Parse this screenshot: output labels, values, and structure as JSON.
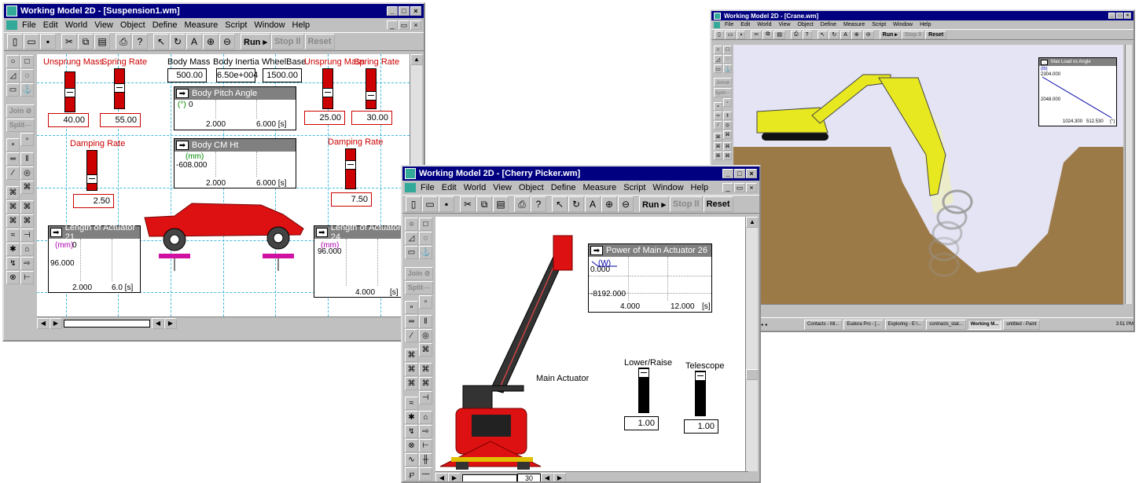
{
  "window1": {
    "title": "Working Model 2D - [Suspension1.wm]",
    "menus": [
      "File",
      "Edit",
      "World",
      "View",
      "Object",
      "Define",
      "Measure",
      "Script",
      "Window",
      "Help"
    ],
    "run": "Run ▸",
    "stop": "Stop ll",
    "reset": "Reset",
    "join": "Join ⊘",
    "split": "Split⋯",
    "labels": {
      "unsprung_mass": "Unsprung Mass",
      "spring_rate": "Spring Rate",
      "body_mass": "Body Mass",
      "body_inertia": "Body Inertia",
      "wheelbase": "WheelBase",
      "unsprung_mass_2": "Unsprung Mass",
      "spring_rate_2": "Spring Rate",
      "damping_rate": "Damping Rate",
      "damping_rate_2": "Damping Rate"
    },
    "values": {
      "unsprung_mass": "40.00",
      "spring_rate": "55.00",
      "body_mass": "500.00",
      "body_inertia": "6.50e+004",
      "wheelbase": "1500.00",
      "unsprung_mass_2": "25.00",
      "spring_rate_2": "30.00",
      "damping_rate": "2.50",
      "damping_rate_2": "7.50"
    },
    "meters": {
      "pitch": {
        "title": "Body Pitch Angle",
        "unit": "(°)",
        "y": "0",
        "x1": "2.000",
        "x2": "6.000  [s]"
      },
      "cm": {
        "title": "Body CM Ht",
        "unit": "(mm)",
        "y": "-608.000",
        "x1": "2.000",
        "x2": "6.000  [s]"
      },
      "act21": {
        "title": "Length of Actuator 21",
        "unit": "(mm)",
        "y0": "0",
        "y": "96.000",
        "x1": "2.000",
        "x2": "6.0  [s]"
      },
      "act24": {
        "title": "Length of Actuator 24",
        "unit": "(mm)",
        "y": "96.000",
        "x2": "4.000",
        "x3": "[s]"
      }
    },
    "scroll_value": ""
  },
  "window2": {
    "title": "Working Model 2D - [Crane.wm]",
    "menus": [
      "File",
      "Edit",
      "World",
      "View",
      "Object",
      "Define",
      "Measure",
      "Script",
      "Window",
      "Help"
    ],
    "run": "Run ▸",
    "stop": "Stop ll",
    "reset": "Reset",
    "join": "Join⊘",
    "split": "Split⋯",
    "meter": {
      "title": "Max Load vs Angle",
      "unit": "(lb)",
      "y1": "2304.000",
      "y2": "2048.000",
      "x1": "1024.300",
      "x2": "512.530",
      "x3": "(°)"
    }
  },
  "taskbar": {
    "items": [
      "Contacts - Mi...",
      "Eudora Pro - [...",
      "Exploring - E:\\...",
      "contracts_stat...",
      "Working M...",
      "untitled - Paint"
    ],
    "clock": "3:51 PM"
  },
  "window3": {
    "title": "Working Model 2D - [Cherry Picker.wm]",
    "menus": [
      "File",
      "Edit",
      "World",
      "View",
      "Object",
      "Define",
      "Measure",
      "Script",
      "Window",
      "Help"
    ],
    "run": "Run ▸",
    "stop": "Stop ll",
    "reset": "Reset",
    "join": "Join ⊘",
    "split": "Split⋯",
    "meter": {
      "title": "Power of Main Actuator 26",
      "unit": "(W)",
      "y1": "0.000",
      "y2": "-8192.000",
      "x1": "4.000",
      "x2": "12.000",
      "x3": "[s]"
    },
    "main_actuator": "Main Actuator",
    "lower_raise": "Lower/Raise",
    "telescope": "Telescope",
    "lower_raise_value": "1.00",
    "telescope_value": "1.00",
    "scroll_value": "30"
  },
  "colors": {
    "title_bar": "#000080",
    "body_red": "#dd1111",
    "crane_yellow": "#ecec20",
    "dirt": "#9c7a48",
    "sky": "#e4e4f4"
  }
}
